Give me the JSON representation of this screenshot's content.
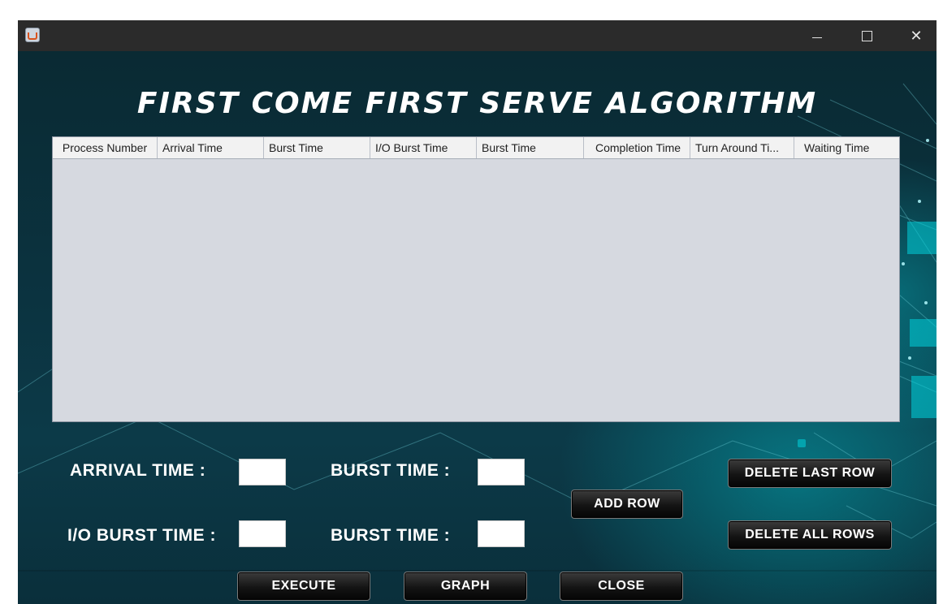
{
  "title": "FIRST COME FIRST SERVE ALGORITHM",
  "table": {
    "columns": [
      "Process Number",
      "Arrival Time",
      "Burst Time",
      "I/O Burst Time",
      "Burst Time",
      "Completion Time",
      "Turn Around Ti...",
      "Waiting Time"
    ],
    "rows": []
  },
  "form": {
    "arrival_time_label": "ARRIVAL TIME  :",
    "burst_time_label_1": "BURST TIME  :",
    "io_burst_time_label": "I/O BURST TIME :",
    "burst_time_label_2": "BURST TIME  :",
    "arrival_time_value": "",
    "burst_time_value_1": "",
    "io_burst_time_value": "",
    "burst_time_value_2": ""
  },
  "buttons": {
    "add_row": "ADD ROW",
    "delete_last_row": "DELETE LAST ROW",
    "delete_all_rows": "DELETE ALL ROWS",
    "execute": "EXECUTE",
    "graph": "GRAPH",
    "close": "CLOSE"
  },
  "icons": {
    "app": "java-cup-icon",
    "minimize": "minimize-icon",
    "maximize": "maximize-icon",
    "close": "close-icon"
  },
  "colors": {
    "background": "#0b3340",
    "button": "#111111",
    "table": "#d6d9e0"
  }
}
